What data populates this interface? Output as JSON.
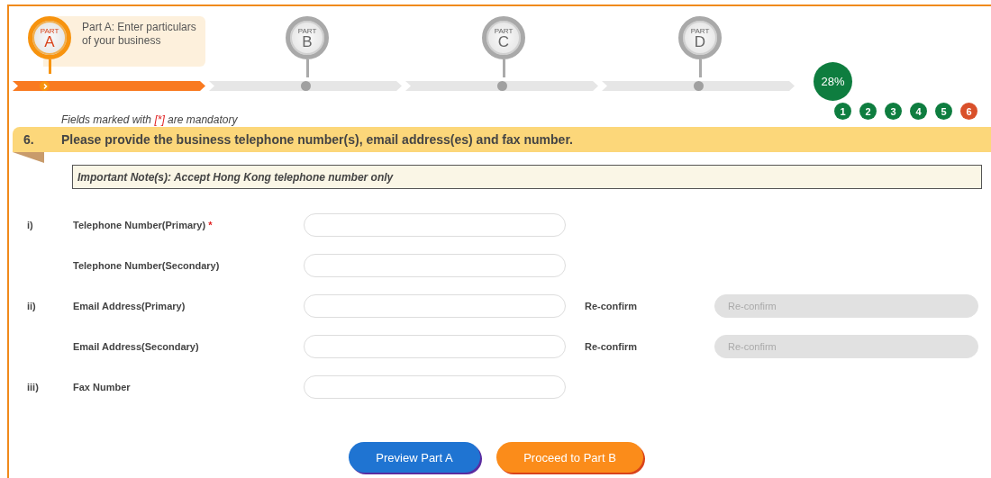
{
  "steps": [
    {
      "small": "PART",
      "letter": "A",
      "caption": "Part A: Enter particulars of your business",
      "selected": true
    },
    {
      "small": "PART",
      "letter": "B",
      "selected": false
    },
    {
      "small": "PART",
      "letter": "C",
      "selected": false
    },
    {
      "small": "PART",
      "letter": "D",
      "selected": false
    }
  ],
  "progress": "28%",
  "sections": [
    {
      "label": "1",
      "selected": false
    },
    {
      "label": "2",
      "selected": false
    },
    {
      "label": "3",
      "selected": false
    },
    {
      "label": "4",
      "selected": false
    },
    {
      "label": "5",
      "selected": false
    },
    {
      "label": "6",
      "selected": true
    }
  ],
  "mandatory_note": {
    "before": "Fields marked with",
    "marker": "[*]",
    "after": "are mandatory"
  },
  "question": {
    "number": "6.",
    "text": "Please provide the business telephone number(s), email address(es) and fax number."
  },
  "important_note": "Important Note(s): Accept Hong Kong telephone number only",
  "fields": [
    {
      "index": "i)",
      "label": "Telephone Number(Primary)",
      "required_mark": "*"
    },
    {
      "label": "Telephone Number(Secondary)"
    },
    {
      "index": "ii)",
      "label": "Email Address(Primary)",
      "confirm": {
        "label": "Re-confirm",
        "placeholder": "Re-confirm",
        "disabled": true
      }
    },
    {
      "label": "Email Address(Secondary)",
      "confirm": {
        "label": "Re-confirm",
        "placeholder": "Re-confirm",
        "disabled": true
      }
    },
    {
      "index": "iii)",
      "label": "Fax Number"
    }
  ],
  "buttons": [
    {
      "label": "Preview Part A",
      "kind": "secondary"
    },
    {
      "label": "Proceed to Part B",
      "kind": "primary"
    }
  ]
}
